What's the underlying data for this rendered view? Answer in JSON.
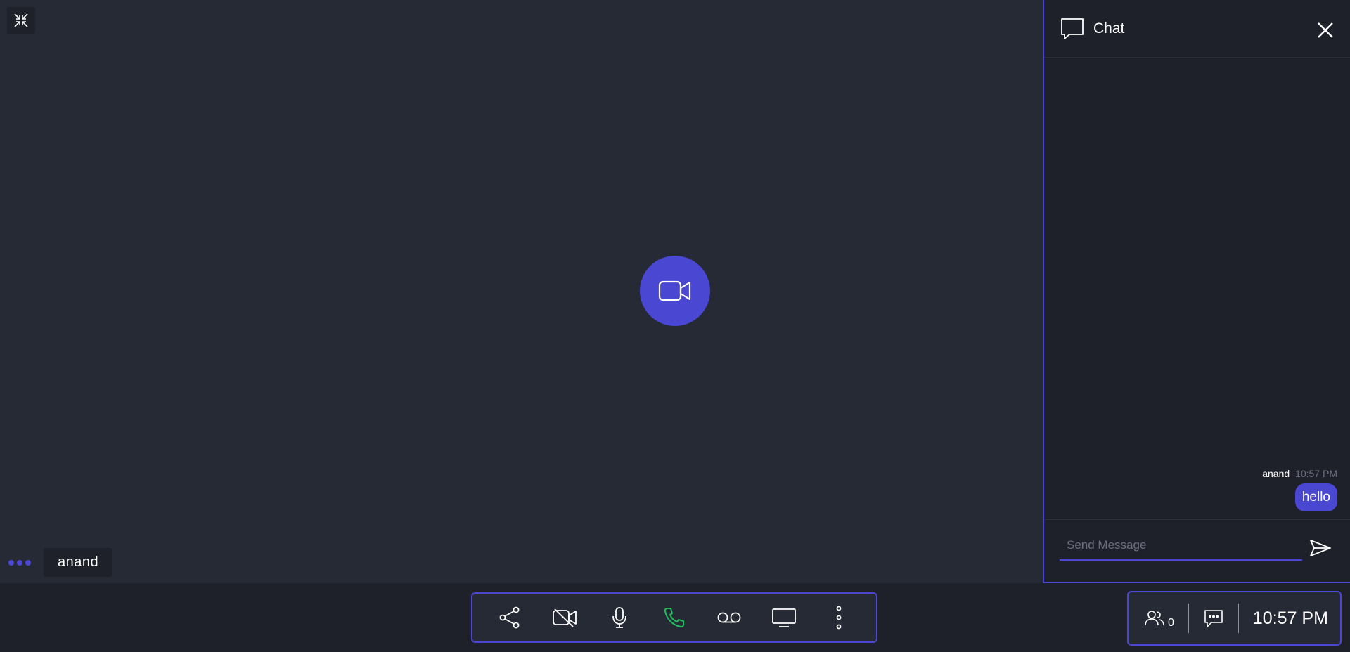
{
  "stage": {
    "participant_name": "anand"
  },
  "chat": {
    "title": "Chat",
    "messages": [
      {
        "author": "anand",
        "time": "10:57 PM",
        "text": "hello"
      }
    ],
    "input_placeholder": "Send Message"
  },
  "toolbar": {
    "icons": [
      "share-icon",
      "video-off-icon",
      "microphone-icon",
      "phone-icon",
      "voicemail-icon",
      "screen-share-icon",
      "more-vertical-icon"
    ]
  },
  "status": {
    "participant_count": "0",
    "clock": "10:57 PM"
  },
  "colors": {
    "accent": "#4a47d3",
    "background": "#262a35",
    "panel": "#1e2129",
    "call_green": "#1ec15b"
  }
}
